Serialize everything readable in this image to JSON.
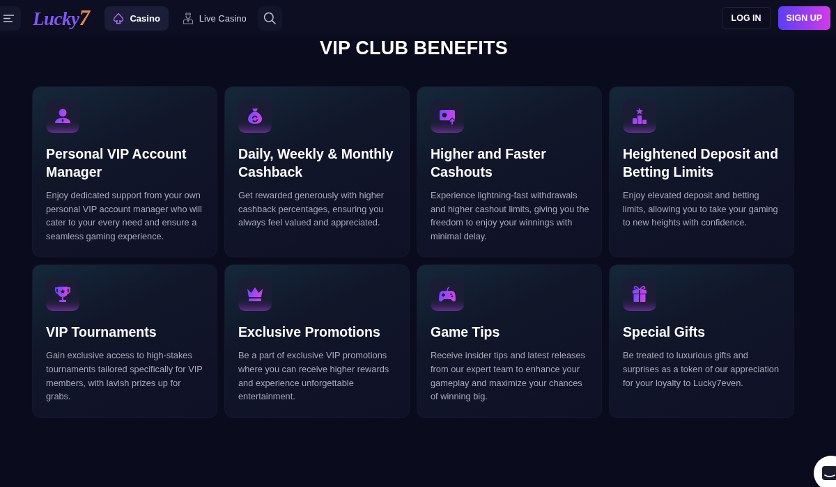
{
  "header": {
    "logo": "Lucky7",
    "nav_tabs": [
      {
        "label": "Casino",
        "selected": true
      },
      {
        "label": "Live Casino",
        "selected": false
      }
    ],
    "login_button": "LOG IN",
    "signup_button": "SIGN UP"
  },
  "section_title": "VIP CLUB BENEFITS",
  "benefits": [
    {
      "title": "Personal VIP Account Manager",
      "description": "Enjoy dedicated support from your own personal VIP account manager who will cater to your every need and ensure a seamless gaming experience."
    },
    {
      "title": "Daily, Weekly & Monthly Cashback",
      "description": "Get rewarded generously with higher cashback percentages, ensuring you always feel valued and appreciated."
    },
    {
      "title": "Higher and Faster Cashouts",
      "description": "Experience lightning-fast withdrawals and higher cashout limits, giving you the freedom to enjoy your winnings with minimal delay."
    },
    {
      "title": "Heightened Deposit and Betting Limits",
      "description": "Enjoy elevated deposit and betting limits, allowing you to take your gaming to new heights with confidence."
    },
    {
      "title": "VIP Tournaments",
      "description": "Gain exclusive access to high-stakes tournaments tailored specifically for VIP members, with lavish prizes up for grabs."
    },
    {
      "title": "Exclusive Promotions",
      "description": "Be a part of exclusive VIP promotions where you can receive higher rewards and experience unforgettable entertainment."
    },
    {
      "title": "Game Tips",
      "description": "Receive insider tips and latest releases from our expert team to enhance your gameplay and maximize your chances of winning big."
    },
    {
      "title": "Special Gifts",
      "description": "Be treated to luxurious gifts and surprises as a token of our appreciation for your loyalty to Lucky7even."
    }
  ]
}
